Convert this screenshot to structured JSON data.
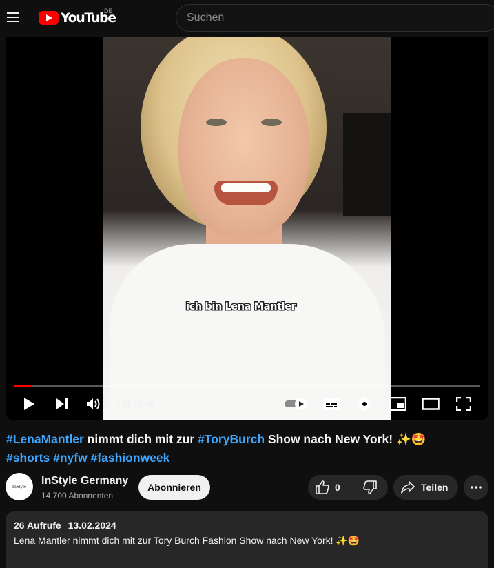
{
  "header": {
    "logo_text": "YouTube",
    "country_code": "DE",
    "search_placeholder": "Suchen"
  },
  "player": {
    "subtitle": "ich bin Lena Mantler",
    "current_time": "0:01",
    "time_separator": "/",
    "duration": "0:40",
    "progress_fraction": 0.04,
    "autoplay": true,
    "icons": [
      "play-icon",
      "next-icon",
      "volume-icon",
      "autoplay-toggle-icon",
      "subtitles-icon",
      "settings-gear-icon",
      "miniplayer-icon",
      "theater-mode-icon",
      "fullscreen-icon"
    ]
  },
  "video": {
    "title_parts": [
      {
        "text": "#LenaMantler",
        "hashtag": true
      },
      {
        "text": " nimmt dich mit zur ",
        "hashtag": false
      },
      {
        "text": "#ToryBurch",
        "hashtag": true
      },
      {
        "text": " Show nach New York! ✨🤩",
        "hashtag": false
      }
    ],
    "tags": [
      "#shorts",
      "#nyfw",
      "#fashionweek"
    ]
  },
  "channel": {
    "avatar_text": "InStyle",
    "name": "InStyle Germany",
    "subscribers": "14.700 Abonnenten",
    "subscribe_label": "Abonnieren"
  },
  "actions": {
    "like_count": "0",
    "share_label": "Teilen"
  },
  "description": {
    "views": "26 Aufrufe",
    "date": "13.02.2024",
    "text": "Lena Mantler nimmt dich mit zur Tory Burch Fashion Show nach New York! ✨🤩"
  },
  "colors": {
    "background": "#0f0f0f",
    "accent": "#ff0000",
    "hashtag": "#3ea6ff",
    "button_bg": "#272727"
  }
}
